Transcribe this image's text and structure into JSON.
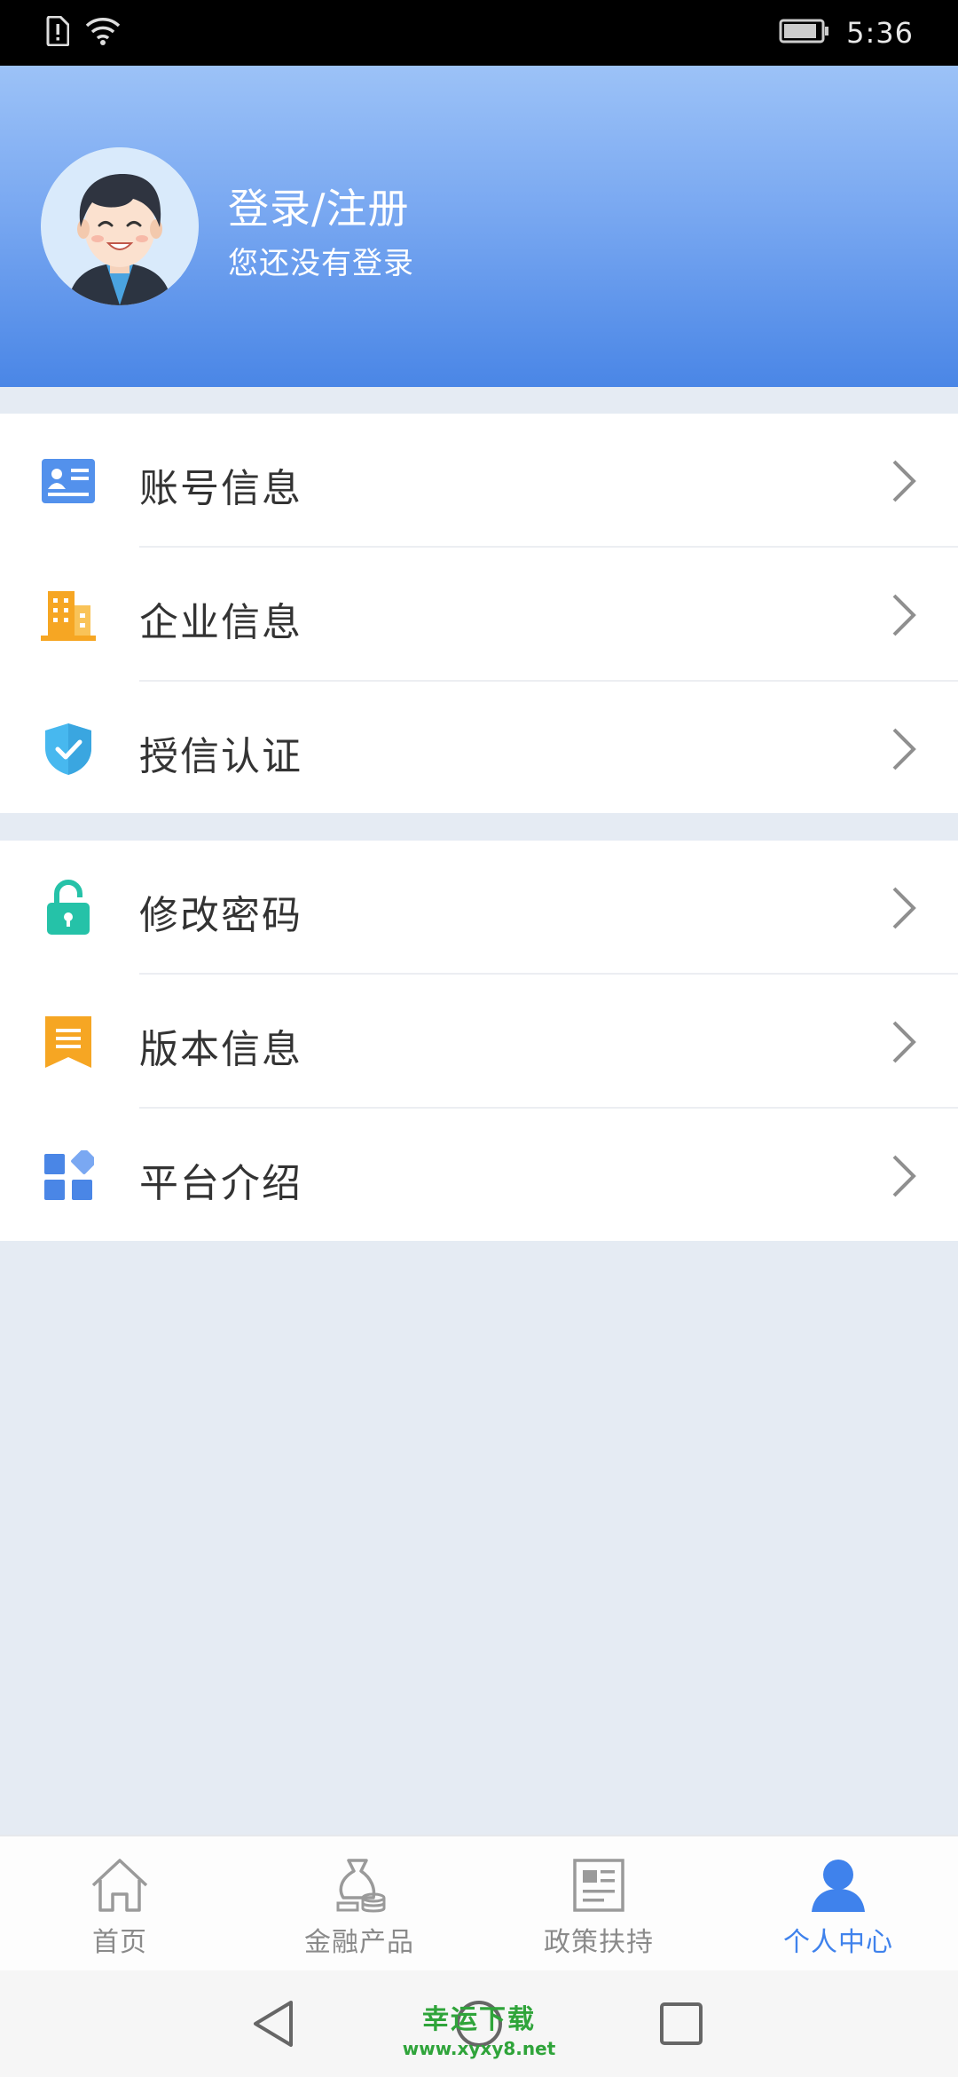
{
  "status_bar": {
    "time": "5:36",
    "icons": [
      "sim-alert-icon",
      "wifi-icon",
      "battery-icon"
    ]
  },
  "header": {
    "title": "登录/注册",
    "subtitle": "您还没有登录",
    "avatar": "avatar-icon"
  },
  "menu": {
    "group1": [
      {
        "label": "账号信息",
        "icon": "id-card-icon",
        "color": "#4a86e6"
      },
      {
        "label": "企业信息",
        "icon": "building-icon",
        "color": "#f7a833"
      },
      {
        "label": "授信认证",
        "icon": "shield-check-icon",
        "color": "#3cb0e8"
      }
    ],
    "group2": [
      {
        "label": "修改密码",
        "icon": "lock-icon",
        "color": "#25c2a8"
      },
      {
        "label": "版本信息",
        "icon": "bookmark-icon",
        "color": "#f7a833"
      },
      {
        "label": "平台介绍",
        "icon": "grid-icon",
        "color": "#4a86e6"
      }
    ]
  },
  "tabbar": {
    "tabs": [
      {
        "label": "首页",
        "icon": "home-icon",
        "active": false
      },
      {
        "label": "金融产品",
        "icon": "money-bag-icon",
        "active": false
      },
      {
        "label": "政策扶持",
        "icon": "document-icon",
        "active": false
      },
      {
        "label": "个人中心",
        "icon": "person-icon",
        "active": true
      }
    ],
    "active_color": "#3f82ec",
    "inactive_color": "#8a8a8a"
  },
  "watermark": {
    "title": "幸运下载",
    "url": "www.xyxy8.net"
  }
}
